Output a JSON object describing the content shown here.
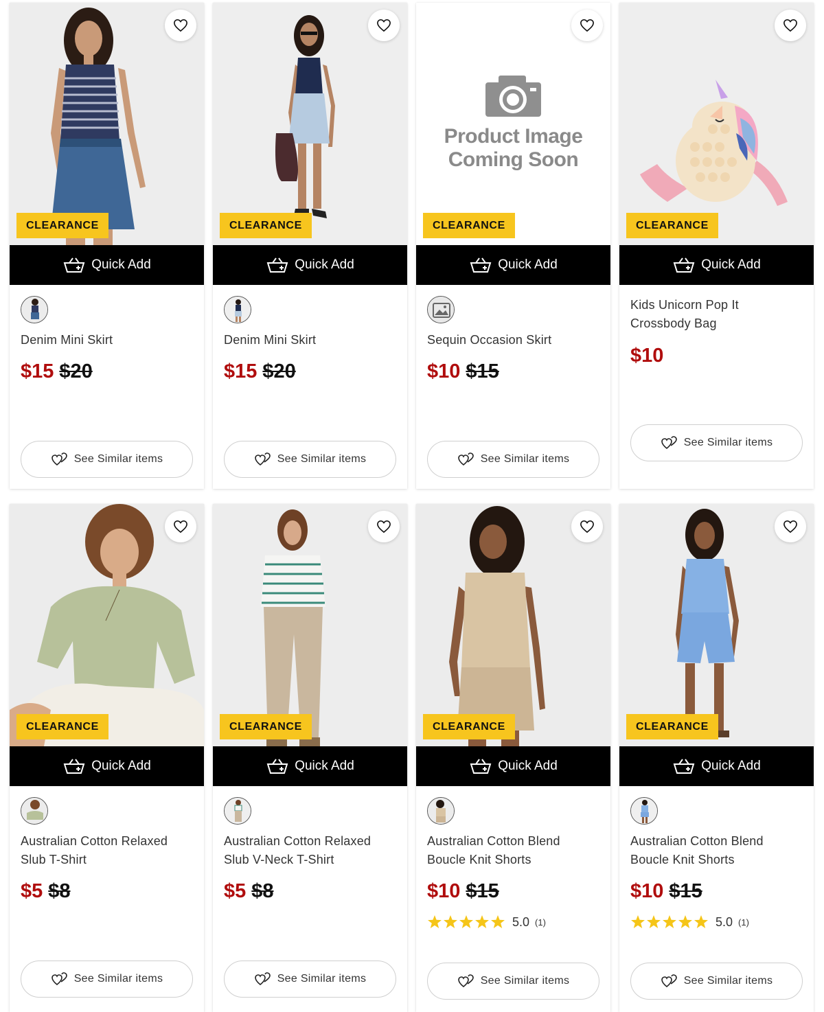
{
  "labels": {
    "badge": "CLEARANCE",
    "quick_add": "Quick Add",
    "see_similar": "See Similar items",
    "placeholder_line1": "Product Image",
    "placeholder_line2": "Coming Soon"
  },
  "colors": {
    "sale_price": "#b00d0d",
    "badge_bg": "#f7c51e",
    "quick_add_bg": "#000000",
    "star": "#f5c518"
  },
  "products": [
    {
      "name": "Denim Mini Skirt",
      "price": "$15",
      "was": "$20",
      "image": "woman-striped-tank-denim-skirt"
    },
    {
      "name": "Denim Mini Skirt",
      "price": "$15",
      "was": "$20",
      "image": "woman-navy-tank-light-denim-skirt-bag"
    },
    {
      "name": "Sequin Occasion Skirt",
      "price": "$10",
      "was": "$15",
      "image": "product-image-coming-soon"
    },
    {
      "name": "Kids Unicorn Pop It Crossbody Bag",
      "price": "$10",
      "was": "",
      "image": "unicorn-pop-it-bag"
    },
    {
      "name": "Australian Cotton Relaxed Slub T-Shirt",
      "price": "$5",
      "was": "$8",
      "image": "woman-sage-tshirt"
    },
    {
      "name": "Australian Cotton Relaxed Slub V-Neck T-Shirt",
      "price": "$5",
      "was": "$8",
      "image": "woman-striped-vneck-khaki-pants"
    },
    {
      "name": "Australian Cotton Blend Boucle Knit Shorts",
      "price": "$10",
      "was": "$15",
      "rating": "5.0",
      "reviews": "(1)",
      "image": "woman-beige-knit-set"
    },
    {
      "name": "Australian Cotton Blend Boucle Knit Shorts",
      "price": "$10",
      "was": "$15",
      "rating": "5.0",
      "reviews": "(1)",
      "image": "woman-blue-knit-set"
    }
  ]
}
